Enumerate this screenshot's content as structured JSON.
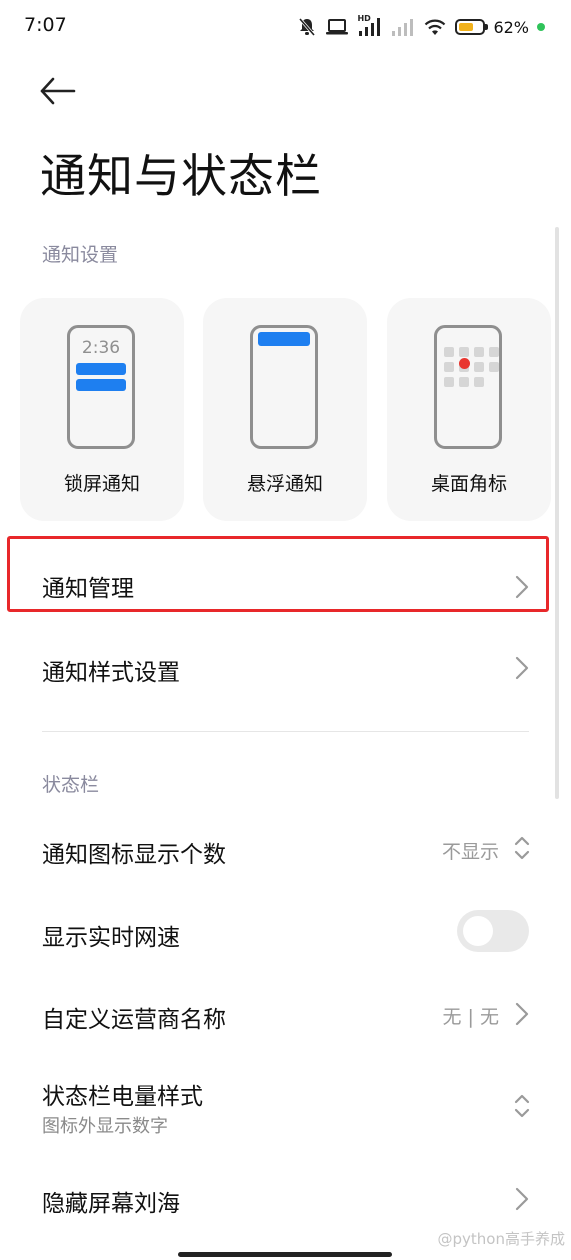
{
  "status_bar": {
    "time": "7:07",
    "battery_text": "62%",
    "battery_level": 0.62,
    "hd_label": "HD",
    "icons": [
      "muted-bell-icon",
      "laptop-icon",
      "hd-signal-icon",
      "signal-icon",
      "wifi-icon",
      "battery-icon",
      "green-dot-icon"
    ]
  },
  "header": {
    "title": "通知与状态栏"
  },
  "notification_settings": {
    "section_title": "通知设置",
    "cards": [
      {
        "label": "锁屏通知",
        "preview_time": "2:36"
      },
      {
        "label": "悬浮通知"
      },
      {
        "label": "桌面角标"
      }
    ]
  },
  "rows": {
    "notification_management": {
      "label": "通知管理"
    },
    "notification_style": {
      "label": "通知样式设置"
    }
  },
  "status_bar_section": {
    "section_title": "状态栏",
    "icon_count": {
      "label": "通知图标显示个数",
      "value": "不显示"
    },
    "network_speed": {
      "label": "显示实时网速",
      "enabled": false
    },
    "carrier_name": {
      "label": "自定义运营商名称",
      "value": "无 | 无"
    },
    "battery_style": {
      "label": "状态栏电量样式",
      "sub": "图标外显示数字"
    },
    "hide_notch": {
      "label": "隐藏屏幕刘海"
    }
  },
  "watermark": "@python高手养成",
  "colors": {
    "accent_blue": "#1e7ff0",
    "badge_red": "#e8362f",
    "highlight_red": "#e8282a",
    "battery_yellow": "#f2b21c"
  }
}
